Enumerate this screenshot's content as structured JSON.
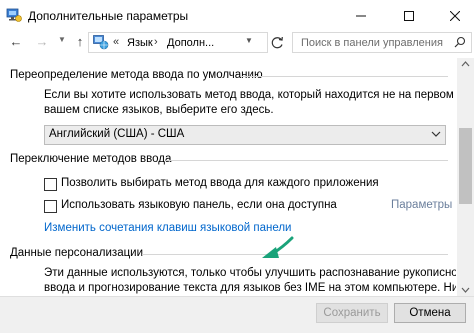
{
  "window": {
    "title": "Дополнительные параметры",
    "min_icon": "minimize-icon",
    "max_icon": "maximize-icon",
    "close_icon": "close-icon"
  },
  "nav": {
    "breadcrumb_prefix": "«",
    "breadcrumb": [
      "Язык",
      "Дополн..."
    ],
    "separator": "›",
    "search_placeholder": "Поиск в панели управления"
  },
  "sections": {
    "override": {
      "title": "Переопределение метода ввода по умолчанию",
      "description_lines": [
        "Если вы хотите использовать метод ввода, который находится не на первом месте в",
        "вашем списке языков, выберите его здесь."
      ],
      "select_value": "Английский (США) - США"
    },
    "switching": {
      "title": "Переключение методов ввода",
      "checkbox1": "Позволить выбирать метод ввода для каждого приложения",
      "checkbox2": "Использовать языковую панель, если она доступна",
      "params_link": "Параметры",
      "hotkeys_link": "Изменить сочетания клавиш языковой панели"
    },
    "personalization": {
      "title": "Данные персонализации",
      "description_lines": [
        "Эти данные используются, только чтобы улучшить распознавание рукописного",
        "ввода и прогнозирование текста для языков без IME на этом компьютере. Никакие"
      ]
    }
  },
  "buttons": {
    "save": "Сохранить",
    "cancel": "Отмена"
  },
  "colors": {
    "link": "#0066cc",
    "annotation_arrow": "#1aa37a"
  }
}
